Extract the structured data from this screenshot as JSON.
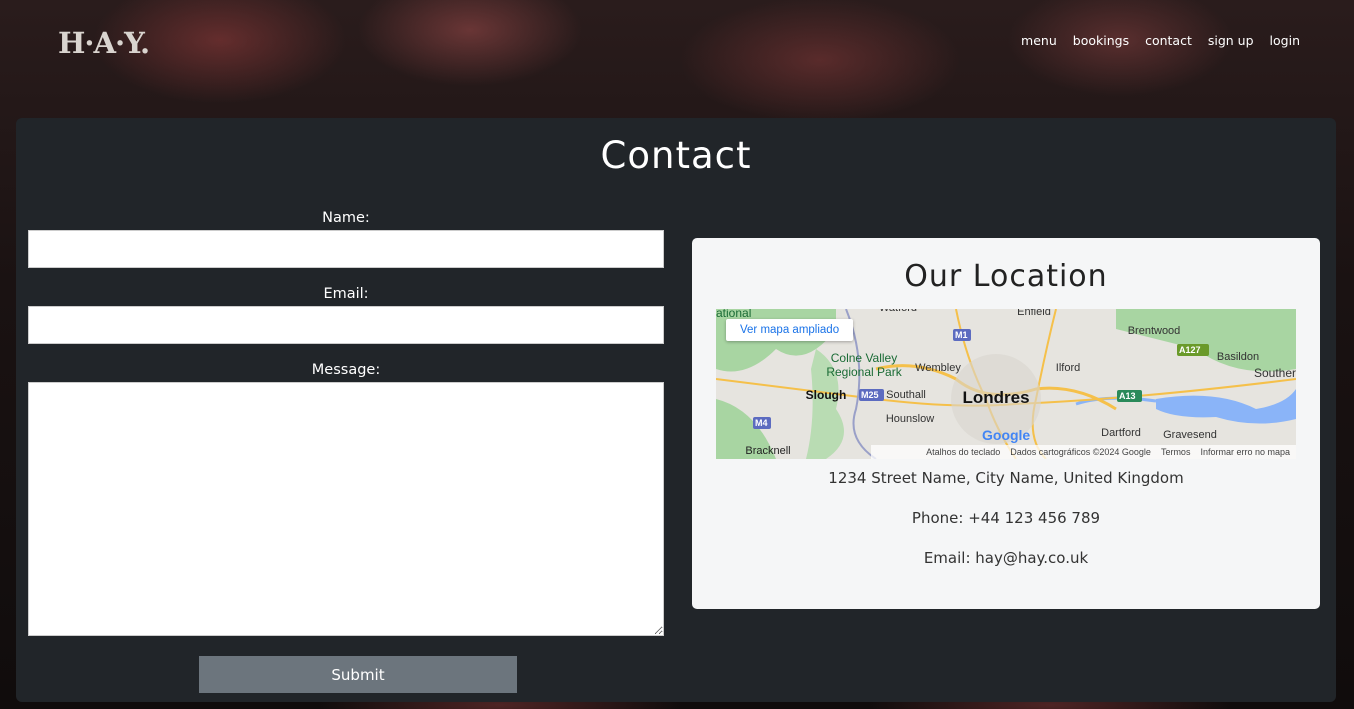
{
  "brand": {
    "logo": "H·A·Y."
  },
  "nav": {
    "items": [
      "menu",
      "bookings",
      "contact",
      "sign up",
      "login"
    ]
  },
  "contact": {
    "title": "Contact",
    "form": {
      "name_label": "Name:",
      "email_label": "Email:",
      "message_label": "Message:",
      "name_value": "",
      "email_value": "",
      "message_value": "",
      "submit_label": "Submit"
    }
  },
  "location": {
    "title": "Our Location",
    "address": "1234 Street Name, City Name, United Kingdom",
    "phone": "Phone: +44 123 456 789",
    "email": "Email: hay@hay.co.uk",
    "map": {
      "button_label": "Ver mapa ampliado",
      "provider": "Google",
      "footer": [
        "Atalhos do teclado",
        "Dados cartográficos ©2024 Google",
        "Termos",
        "Informar erro no mapa"
      ],
      "place_labels": [
        "ational",
        "Watford",
        "Enfield",
        "Brentwood",
        "Basildon",
        "Souther",
        "Colne Valley",
        "Regional Park",
        "Wembley",
        "Ilford",
        "Slough",
        "Southall",
        "Londres",
        "Hounslow",
        "Dartford",
        "Gravesend",
        "Bracknell"
      ],
      "road_labels": [
        "M1",
        "M25",
        "M4",
        "A127",
        "A13"
      ],
      "colors": {
        "land": "#e6e4df",
        "green": "#a8d5a2",
        "water": "#8ab4f8",
        "road": "#f5c04a"
      }
    }
  }
}
